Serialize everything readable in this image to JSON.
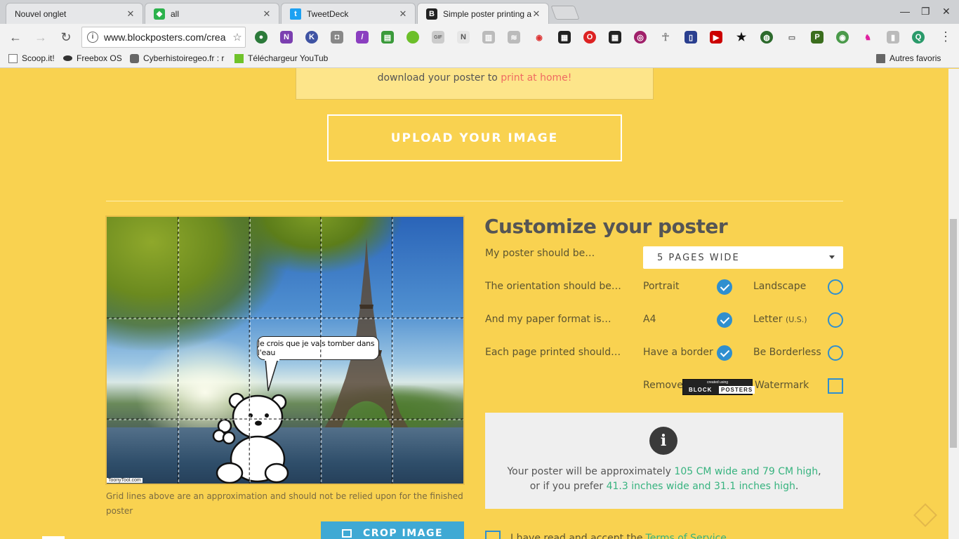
{
  "tabs": [
    {
      "label": "Nouvel onglet",
      "icon": "blank-page-icon",
      "color": "#e6e7e9"
    },
    {
      "label": "all",
      "icon": "feedly-icon",
      "color": "#2bb24c"
    },
    {
      "label": "TweetDeck",
      "icon": "twitter-icon",
      "color": "#1da1f2"
    },
    {
      "label": "Simple poster printing a",
      "icon": "blockposters-icon",
      "color": "#222222"
    }
  ],
  "toolbar": {
    "url": "www.blockposters.com/crea",
    "back": "←",
    "forward": "→",
    "reload": "↻",
    "star": "☆",
    "menu": "⋮",
    "win_min": "—",
    "win_max": "❐",
    "win_close": "✕"
  },
  "bookmarks": [
    {
      "label": "Scoop.it!",
      "icon": "page-icon"
    },
    {
      "label": "Freebox OS",
      "icon": "freebox-icon"
    },
    {
      "label": "Cyberhistoiregeo.fr : r",
      "icon": "wolf-icon"
    },
    {
      "label": "Téléchargeur YouTub",
      "icon": "download-arrow-icon"
    },
    {
      "label": "Autres favoris",
      "icon": "folder-icon"
    }
  ],
  "page": {
    "notice_text": "download your poster to",
    "notice_link": "print at home!",
    "upload_label": "UPLOAD YOUR IMAGE",
    "bubble_text": "Je crois que je vais tomber dans l'eau",
    "toony_credit": "ToonyTool.com",
    "grid_note": "Grid lines above are an approximation and should not be relied upon for the finished poster",
    "crop_label": "CROP IMAGE"
  },
  "customize": {
    "title": "Customize your poster",
    "size_label": "My poster should be…",
    "size_value": "5 PAGES WIDE",
    "orientation_label": "The orientation should be…",
    "orientation_options": [
      "Portrait",
      "Landscape"
    ],
    "orientation_selected": "Portrait",
    "paper_label": "And my paper format is…",
    "paper_options": [
      "A4",
      "Letter"
    ],
    "paper_letter_note": "(U.S.)",
    "paper_selected": "A4",
    "border_label": "Each page printed should…",
    "border_options": [
      "Have a border",
      "Be Borderless"
    ],
    "border_selected": "Have a border",
    "watermark_pre": "Remove",
    "watermark_post": "Watermark",
    "watermark_badge_small": "created using",
    "watermark_badge_block": "BLOCK",
    "watermark_badge_posters": "POSTERS"
  },
  "info": {
    "icon": "i",
    "line1_pre": "Your poster will be approximately",
    "line1_value": "105 CM wide and 79 CM high",
    "line1_post": ",",
    "line2_pre": "or if you prefer",
    "line2_value": "41.3 inches wide and 31.1 inches high",
    "line2_post": "."
  },
  "terms": {
    "text": "I have read and accept the",
    "link": "Terms of Service"
  },
  "colors": {
    "page_bg": "#f9d250",
    "accent_blue": "#2f8fcf",
    "accent_green": "#37b37f",
    "link_red": "#ef6b62",
    "crop_button": "#3fa9d4"
  }
}
